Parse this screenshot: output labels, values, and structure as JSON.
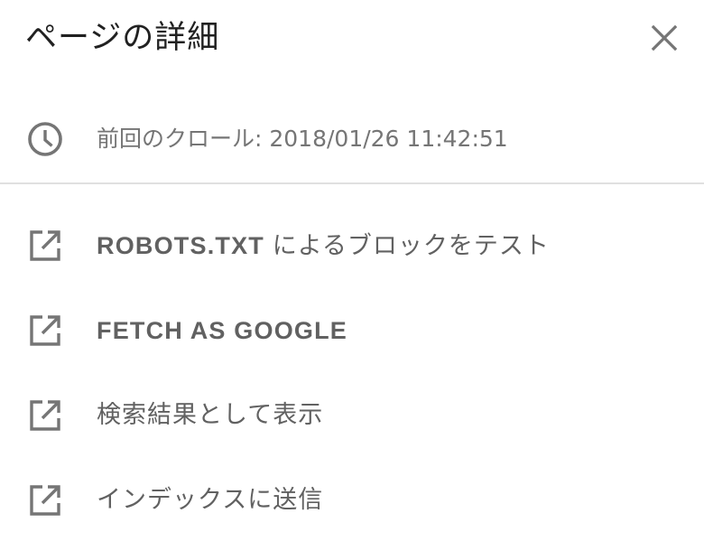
{
  "dialog": {
    "title": "ページの詳細",
    "close_icon": "close-icon"
  },
  "crawl": {
    "icon": "clock-icon",
    "text": "前回のクロール: 2018/01/26 11:42:51"
  },
  "actions": [
    {
      "icon": "open-in-new-icon",
      "label_primary": "ROBOTS.TXT",
      "label_secondary": "によるブロックをテスト"
    },
    {
      "icon": "open-in-new-icon",
      "label": "FETCH AS GOOGLE"
    },
    {
      "icon": "open-in-new-icon",
      "label": "検索結果として表示"
    },
    {
      "icon": "open-in-new-icon",
      "label": "インデックスに送信"
    }
  ],
  "colors": {
    "title": "#212121",
    "text": "#616161",
    "secondary_text": "#757575",
    "icon": "#757575",
    "divider": "#e0e0e0",
    "background": "#ffffff"
  }
}
